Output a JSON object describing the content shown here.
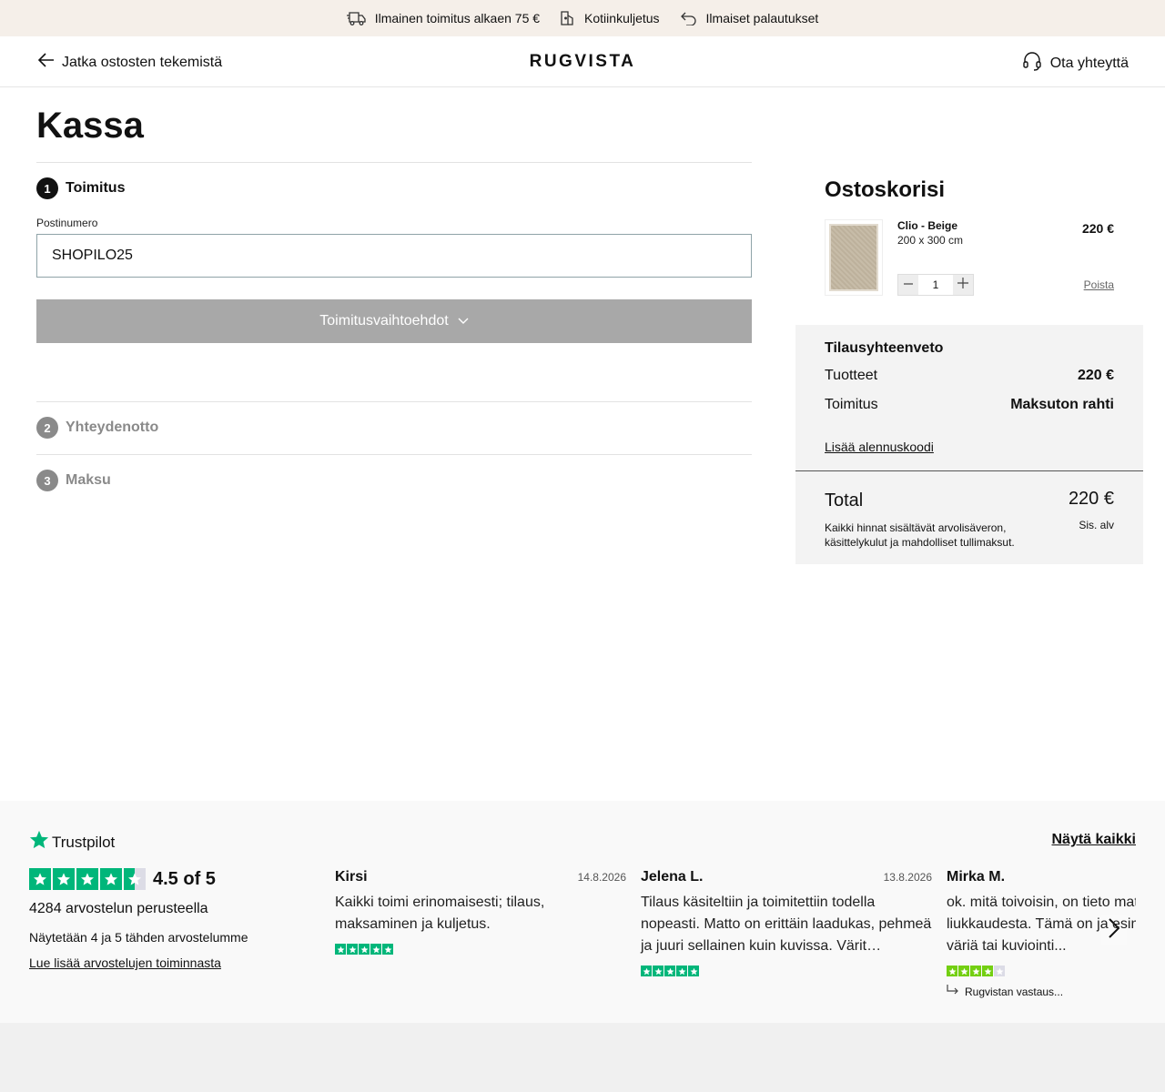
{
  "topbar": {
    "perks": [
      {
        "icon": "truck-icon",
        "label": "Ilmainen toimitus alkaen 75 €"
      },
      {
        "icon": "home-delivery-icon",
        "label": "Kotiinkuljetus"
      },
      {
        "icon": "return-arrow-icon",
        "label": "Ilmaiset palautukset"
      }
    ]
  },
  "header": {
    "back_label": "Jatka ostosten tekemistä",
    "logo": "RUGVISTA",
    "contact_label": "Ota yhteyttä"
  },
  "checkout": {
    "title": "Kassa",
    "steps": [
      {
        "number": "1",
        "label": "Toimitus",
        "state": "active"
      },
      {
        "number": "2",
        "label": "Yhteydenotto",
        "state": "inactive"
      },
      {
        "number": "3",
        "label": "Maksu",
        "state": "inactive"
      }
    ],
    "postal_label": "Postinumero",
    "postal_value": "SHOPILO25",
    "shipping_button": "Toimitusvaihtoehdot"
  },
  "cart": {
    "title": "Ostoskorisi",
    "item": {
      "name": "Clio - Beige",
      "size": "200 x 300 cm",
      "price": "220 €",
      "quantity": "1",
      "remove_label": "Poista"
    },
    "summary": {
      "title": "Tilausyhteenveto",
      "rows": [
        {
          "label": "Tuotteet",
          "value": "220 €"
        },
        {
          "label": "Toimitus",
          "value": "Maksuton rahti"
        }
      ],
      "discount_link": "Lisää alennuskoodi",
      "total_label": "Total",
      "total_value": "220 €",
      "vat_note": "Sis. alv",
      "disclaimer": "Kaikki hinnat sisältävät arvolisäveron, käsittelykulut ja mahdolliset tullimaksut."
    }
  },
  "trustpilot": {
    "brand": "Trustpilot",
    "see_all": "Näytä kaikki",
    "rating": 4.5,
    "score_text": "4.5 of 5",
    "basis": "4284 arvostelun perusteella",
    "showing": "Näytetään 4 ja 5 tähden arvostelumme",
    "read_more": "Lue lisää arvostelujen toiminnasta",
    "reviews": [
      {
        "name": "Kirsi",
        "date": "14.8.2026",
        "text": "Kaikki toimi erinomaisesti; tilaus, maksaminen ja kuljetus.",
        "stars": 5
      },
      {
        "name": "Jelena L.",
        "date": "13.8.2026",
        "text": "Tilaus käsiteltiin ja toimitettiin todella nopeasti. Matto on erittäin laadukas, pehmeä ja juuri sellainen kuin kuvissa. Värit…",
        "stars": 5
      },
      {
        "name": "Mirka M.",
        "date": "",
        "text": "ok. mitä toivoisin, on tieto mat liukkaudesta. Tämä on ja esim väriä tai kuviointi...",
        "stars": 4,
        "reply": "Rugvistan vastaus..."
      }
    ]
  },
  "colors": {
    "topbar_bg": "#f5efe9",
    "trustpilot_green": "#00b67a",
    "four_star_green": "#73cf11",
    "disabled_button": "#a8a8a8",
    "summary_bg": "#f3f3f3"
  }
}
